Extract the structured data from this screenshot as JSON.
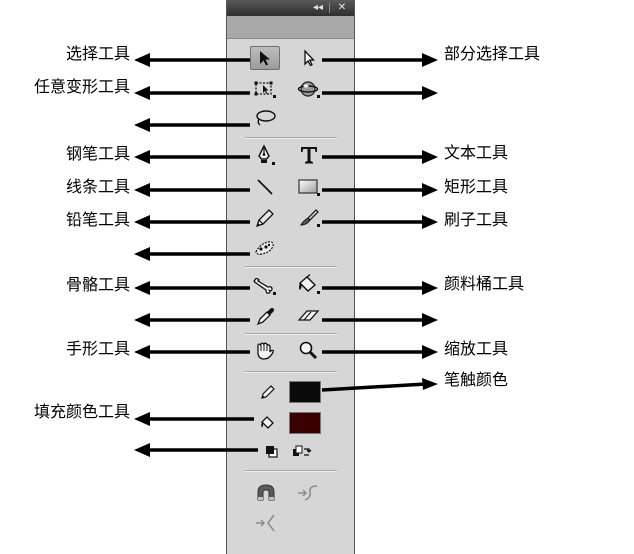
{
  "panel": {
    "collapse_glyph": "◂◂",
    "close_glyph": "✕",
    "stroke_color": "#0a0a0a",
    "fill_color": "#3a0000"
  },
  "labels": {
    "selection_tool": "选择工具",
    "subselection_tool": "部分选择工具",
    "free_transform_tool": "任意变形工具",
    "pen_tool": "钢笔工具",
    "text_tool": "文本工具",
    "line_tool": "线条工具",
    "rectangle_tool": "矩形工具",
    "pencil_tool": "铅笔工具",
    "brush_tool": "刷子工具",
    "bone_tool": "骨骼工具",
    "paint_bucket_tool": "颜料桶工具",
    "hand_tool": "手形工具",
    "zoom_tool": "缩放工具",
    "stroke_color": "笔触颜色",
    "fill_color": "填充颜色工具"
  }
}
